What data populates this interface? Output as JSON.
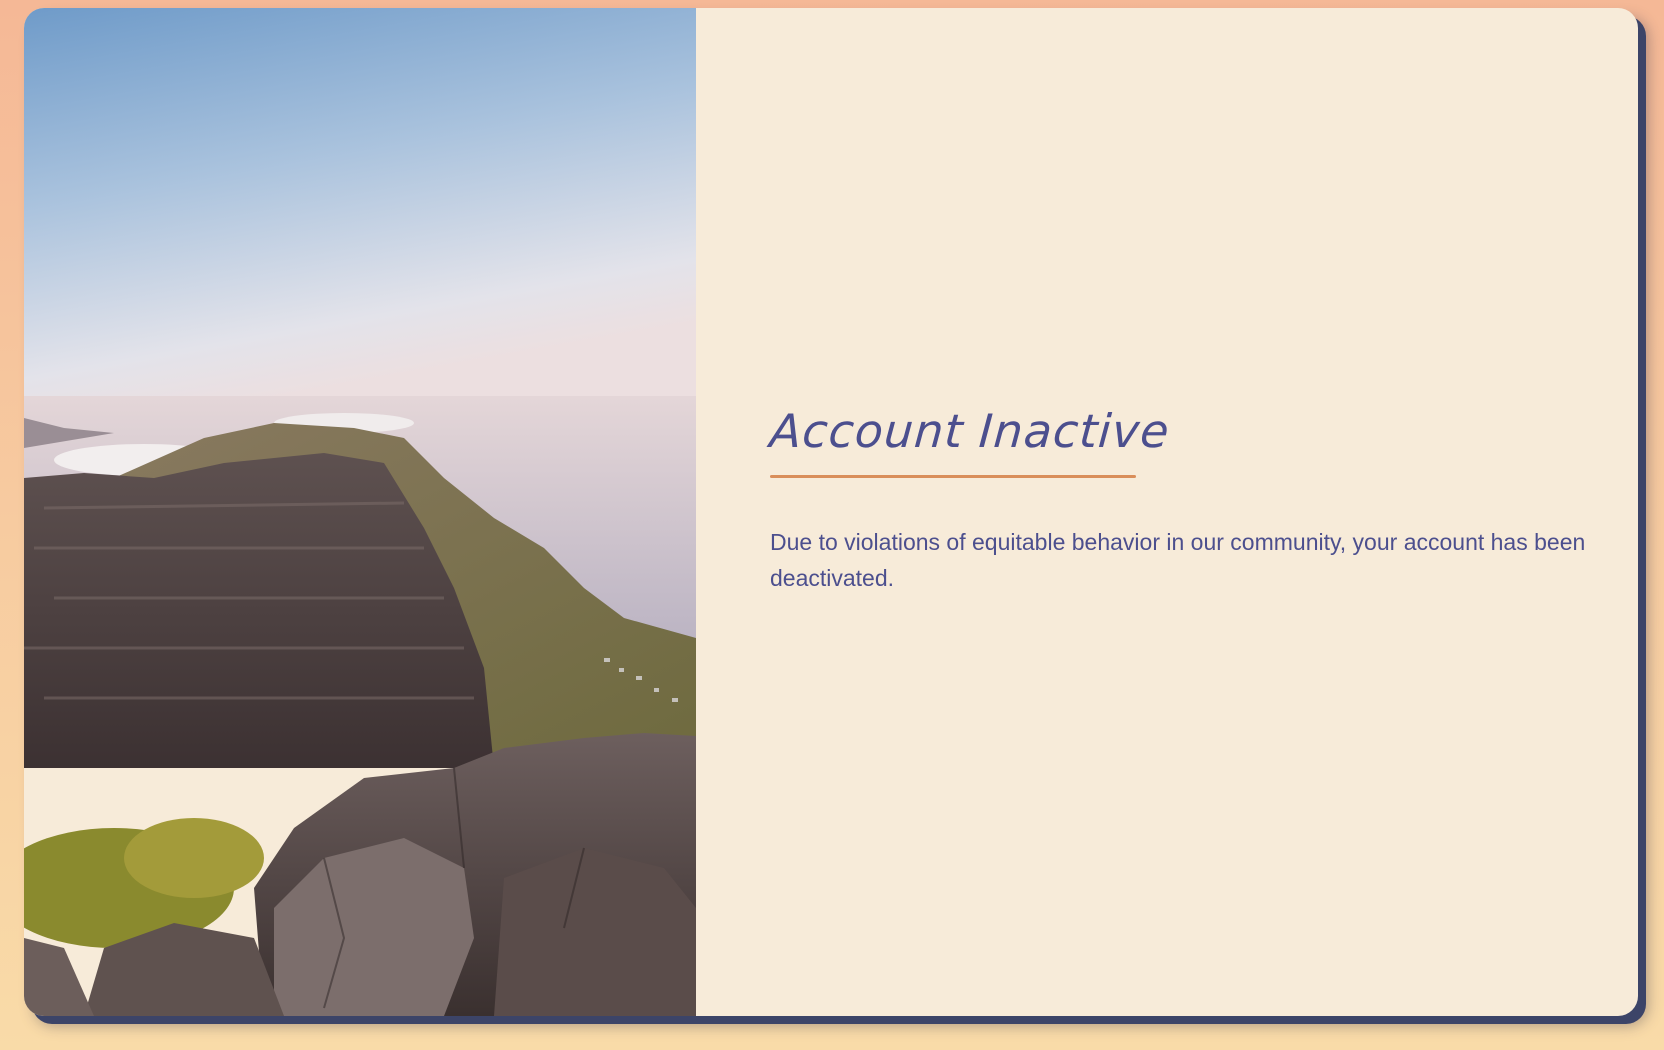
{
  "hero_image": {
    "description_icon": "mountain-coast-photo"
  },
  "notice": {
    "title": "Account Inactive",
    "message": "Due to violations of equitable behavior in our community, your account has been deactivated."
  },
  "colors": {
    "background_top": "#f5b896",
    "background_bottom": "#f9dba8",
    "card": "#f7ebd9",
    "text": "#4c4f8e",
    "accent_underline": "#d98e5a",
    "shadow": "#3c4468"
  }
}
